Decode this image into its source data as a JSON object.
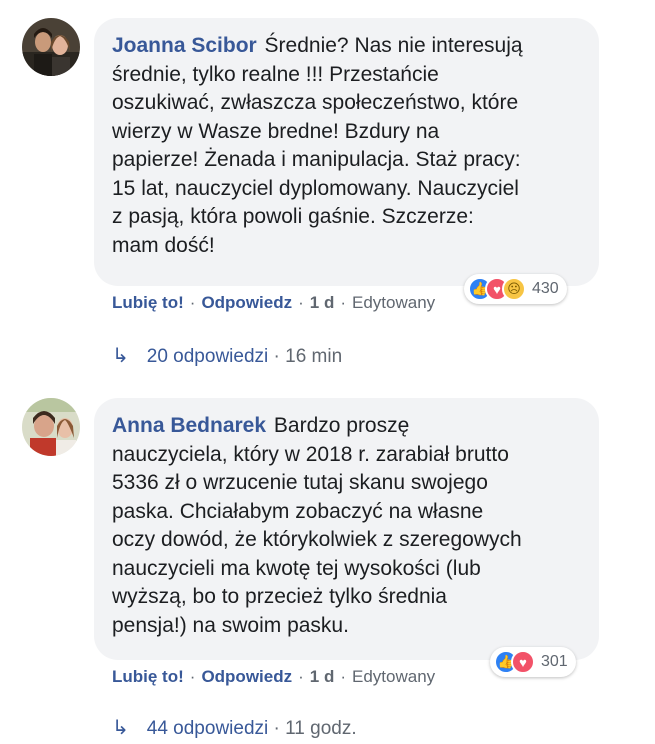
{
  "comments": [
    {
      "author": "Joanna Scibor",
      "text": "Średnie? Nas nie interesują średnie, tylko realne !!! Przestańcie oszukiwać, zwłaszcza społeczeństwo, które wierzy w Wasze bzdury na papierze! Żenada i manipulacja. Staż pracy: 15 lat, nauczyciel dyplomowany. Nauczyciel z pasją, która powoli gaśnie. Szczerze: mam dość!",
      "text_lines": [
        "Średnie? Nas nie interesują",
        "średnie, tylko realne !!! Przestańcie",
        "oszukiwać, zwłaszcza społeczeństwo, które",
        "wierzy w Wasze bredne! Bzdury na",
        "papierze! Żenada i manipulacja. Staż pracy:",
        "15 lat, nauczyciel dyplomowany. Nauczyciel",
        "z pasją, która powoli gaśnie. Szczerze:",
        "mam dość!"
      ],
      "reactions": [
        "like-icon",
        "love-icon",
        "sad-icon"
      ],
      "reaction_count": "430",
      "like_label": "Lubię to!",
      "reply_label": "Odpowiedz",
      "time": "1 d",
      "edited_label": "Edytowany",
      "replies_label": "20 odpowiedzi",
      "replies_time": "16 min"
    },
    {
      "author": "Anna Bednarek",
      "text_lines": [
        "Bardzo proszę",
        "nauczyciela, który w 2018 r. zarabiał brutto",
        "5336 zł o wrzucenie tutaj skanu swojego",
        "paska. Chciałabym zobaczyć na własne",
        "oczy dowód, że którykolwiek z szeregowych",
        "nauczycieli ma kwotę tej wysokości (lub",
        "wyższą, bo to przecież tylko średnia",
        "pensja!) na swoim pasku."
      ],
      "reactions": [
        "like-icon",
        "love-icon"
      ],
      "reaction_count": "301",
      "like_label": "Lubię to!",
      "reply_label": "Odpowiedz",
      "time": "1 d",
      "edited_label": "Edytowany",
      "replies_label": "44 odpowiedzi",
      "replies_time": "11 godz."
    }
  ],
  "separator": "·",
  "colors": {
    "link": "#385898",
    "bubble": "#f2f3f5",
    "meta": "#606770"
  }
}
